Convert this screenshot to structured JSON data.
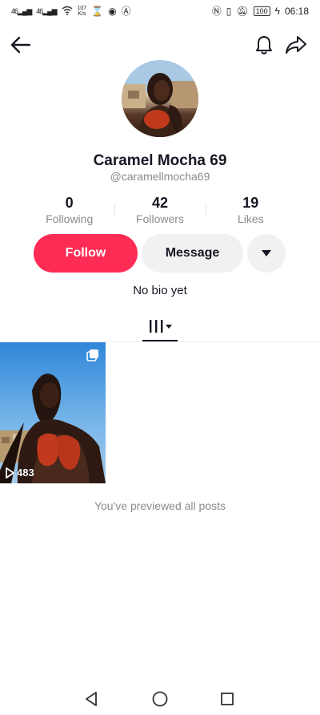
{
  "status_bar": {
    "signal_1": "46",
    "signal_2": "46",
    "net_speed_value": "107",
    "net_speed_unit": "K/s",
    "battery": "100",
    "time": "06:18"
  },
  "profile": {
    "display_name": "Caramel Mocha 69",
    "username": "@caramellmocha69",
    "bio": "No bio yet"
  },
  "stats": [
    {
      "value": "0",
      "label": "Following"
    },
    {
      "value": "42",
      "label": "Followers"
    },
    {
      "value": "19",
      "label": "Likes"
    }
  ],
  "actions": {
    "follow_label": "Follow",
    "message_label": "Message"
  },
  "videos": [
    {
      "views": "483"
    }
  ],
  "end_note": "You've previewed all posts",
  "colors": {
    "accent": "#fe2c55",
    "secondary_button": "#f1f1f2",
    "text_primary": "#161823",
    "text_secondary": "#8a8b91"
  },
  "icons": {
    "back": "arrow-left-icon",
    "notifications": "bell-icon",
    "share": "share-arrow-icon",
    "more": "caret-down-icon",
    "videos_tab": "grid-bars-icon",
    "multi": "carousel-icon",
    "play": "play-icon"
  }
}
